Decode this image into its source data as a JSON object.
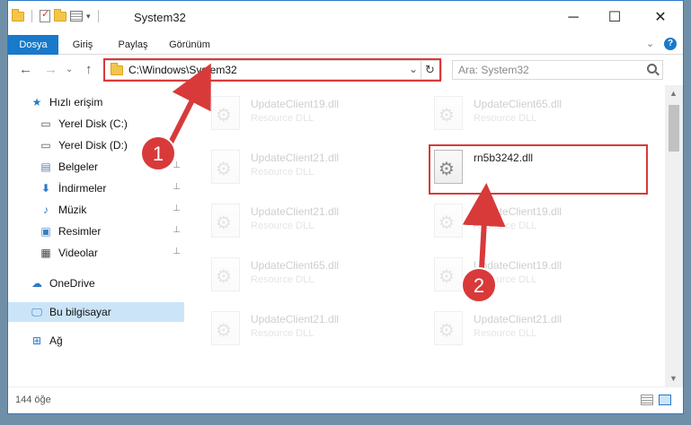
{
  "window": {
    "title": "System32"
  },
  "ribbon": {
    "tabs": [
      "Dosya",
      "Giriş",
      "Paylaş",
      "Görünüm"
    ]
  },
  "address": {
    "path": "C:\\Windows\\System32",
    "search_placeholder": "Ara: System32"
  },
  "nav": {
    "quick_access": "Hızlı erişim",
    "items": [
      {
        "label": "Yerel Disk (C:)",
        "icon": "drive-icon"
      },
      {
        "label": "Yerel Disk (D:)",
        "icon": "drive-icon"
      },
      {
        "label": "Belgeler",
        "icon": "documents-icon"
      },
      {
        "label": "İndirmeler",
        "icon": "downloads-icon"
      },
      {
        "label": "Müzik",
        "icon": "music-icon"
      },
      {
        "label": "Resimler",
        "icon": "pictures-icon"
      },
      {
        "label": "Videolar",
        "icon": "videos-icon"
      }
    ],
    "onedrive": "OneDrive",
    "this_pc": "Bu bilgisayar",
    "network": "Ağ"
  },
  "files": [
    {
      "name": "UpdateClient19.dll",
      "type": "Resource DLL"
    },
    {
      "name": "UpdateClient65.dll",
      "type": "Resource DLL"
    },
    {
      "name": "UpdateClient21.dll",
      "type": "Resource DLL"
    },
    {
      "name": "rn5b3242.dll",
      "type": ""
    },
    {
      "name": "UpdateClient21.dll",
      "type": "Resource DLL"
    },
    {
      "name": "UpdateClient19.dll",
      "type": "Resource DLL"
    },
    {
      "name": "UpdateClient65.dll",
      "type": "Resource DLL"
    },
    {
      "name": "UpdateClient19.dll",
      "type": "Resource DLL"
    },
    {
      "name": "UpdateClient21.dll",
      "type": "Resource DLL"
    },
    {
      "name": "UpdateClient21.dll",
      "type": "Resource DLL"
    }
  ],
  "status": {
    "count": "144 öğe"
  },
  "annotations": {
    "step1": "1",
    "step2": "2",
    "color": "#d83a3a"
  }
}
